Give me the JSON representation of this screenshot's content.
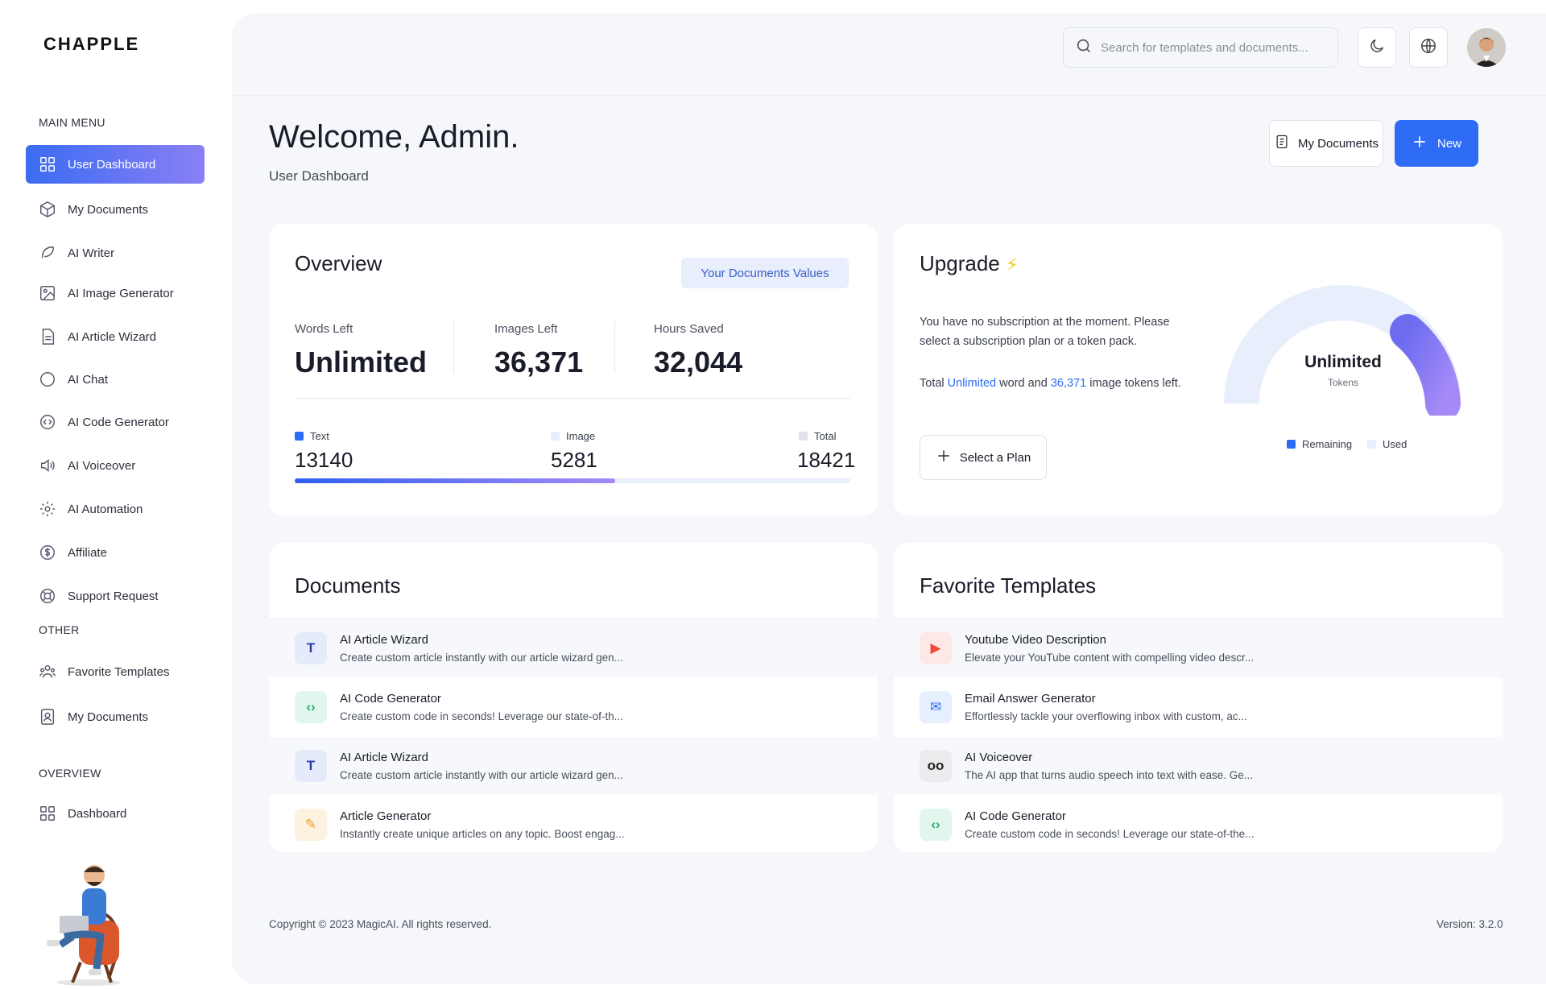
{
  "brand": {
    "logo": "CHAPPLE"
  },
  "sidebar": {
    "sections": [
      {
        "heading": "MAIN MENU"
      },
      {
        "heading": "OTHER"
      },
      {
        "heading": "OVERVIEW"
      }
    ],
    "main_items": [
      {
        "label": "User Dashboard",
        "icon": "grid-icon",
        "active": true
      },
      {
        "label": "My Documents",
        "icon": "box-icon"
      },
      {
        "label": "AI Writer",
        "icon": "feather-icon"
      },
      {
        "label": "AI Image Generator",
        "icon": "image-icon"
      },
      {
        "label": "AI Article Wizard",
        "icon": "document-icon"
      },
      {
        "label": "AI Chat",
        "icon": "chat-icon"
      },
      {
        "label": "AI Code Generator",
        "icon": "code-icon"
      },
      {
        "label": "AI Voiceover",
        "icon": "speaker-icon"
      },
      {
        "label": "AI Automation",
        "icon": "gear-icon"
      },
      {
        "label": "Affiliate",
        "icon": "dollar-icon"
      },
      {
        "label": "Support Request",
        "icon": "lifebuoy-icon"
      }
    ],
    "other_items": [
      {
        "label": "Favorite Templates",
        "icon": "users-icon"
      },
      {
        "label": "My Documents",
        "icon": "user-file-icon"
      }
    ],
    "overview_items": [
      {
        "label": "Dashboard",
        "icon": "grid-icon"
      }
    ]
  },
  "topbar": {
    "search_placeholder": "Search for templates and documents..."
  },
  "header": {
    "title": "Welcome, Admin.",
    "subtitle": "User Dashboard",
    "docs_button": "My Documents",
    "new_button": "New"
  },
  "overview": {
    "title": "Overview",
    "tag": "Your Documents Values",
    "stats": [
      {
        "label": "Words Left",
        "value": "Unlimited"
      },
      {
        "label": "Images Left",
        "value": "36,371"
      },
      {
        "label": "Hours Saved",
        "value": "32,044"
      }
    ],
    "breakdown": [
      {
        "label": "Text",
        "value": "13140",
        "color": "#2f6cf5"
      },
      {
        "label": "Image",
        "value": "5281",
        "color": "#e8eefc"
      },
      {
        "label": "Total",
        "value": "18421",
        "color": "#e1e3ea"
      }
    ],
    "progress_fraction": 0.577
  },
  "upgrade": {
    "title": "Upgrade",
    "bolt_icon": "lightning-icon",
    "message": "You have no subscription at the moment. Please select a subscription plan or a token pack.",
    "tokens_prefix": "Total",
    "tokens_words": "Unlimited",
    "tokens_mid": "word and",
    "tokens_images": "36,371",
    "tokens_suffix": "image tokens left.",
    "plan_button": "Select a Plan",
    "gauge": {
      "value": "Unlimited",
      "label": "Tokens",
      "legend_remaining": "Remaining",
      "legend_used": "Used",
      "remaining_color": "#2f6cf5",
      "used_color": "#e8eefc"
    }
  },
  "documents": {
    "title": "Documents",
    "items": [
      {
        "title": "AI Article Wizard",
        "desc": "Create custom article instantly with our article wizard gen...",
        "icon": "T",
        "icon_bg": "#e6ebfb",
        "icon_color": "#2a3da8"
      },
      {
        "title": "AI Code Generator",
        "desc": "Create custom code in seconds! Leverage our state-of-th...",
        "icon": "‹›",
        "icon_bg": "#e3f6ee",
        "icon_color": "#1fae73"
      },
      {
        "title": "AI Article Wizard",
        "desc": "Create custom article instantly with our article wizard gen...",
        "icon": "T",
        "icon_bg": "#e6ebfb",
        "icon_color": "#2a3da8"
      },
      {
        "title": "Article Generator",
        "desc": "Instantly create unique articles on any topic. Boost engag...",
        "icon": "✎",
        "icon_bg": "#fdf1e0",
        "icon_color": "#f0a020"
      }
    ]
  },
  "favorites": {
    "title": "Favorite Templates",
    "items": [
      {
        "title": "Youtube Video Description",
        "desc": "Elevate your YouTube content with compelling video descr...",
        "icon": "▶",
        "icon_bg": "#fde8e6",
        "icon_color": "#ec4b3a"
      },
      {
        "title": "Email Answer Generator",
        "desc": "Effortlessly tackle your overflowing inbox with custom, ac...",
        "icon": "✉",
        "icon_bg": "#e6effc",
        "icon_color": "#2f6cf5"
      },
      {
        "title": "AI Voiceover",
        "desc": "The AI app that turns audio speech into text with ease. Ge...",
        "icon": "oo",
        "icon_bg": "#ececef",
        "icon_color": "#222"
      },
      {
        "title": "AI Code Generator",
        "desc": "Create custom code in seconds! Leverage our state-of-the...",
        "icon": "‹›",
        "icon_bg": "#e3f6ee",
        "icon_color": "#1fae73"
      }
    ]
  },
  "footer": {
    "copyright": "Copyright © 2023 MagicAI. All rights reserved.",
    "version": "Version: 3.2.0"
  }
}
